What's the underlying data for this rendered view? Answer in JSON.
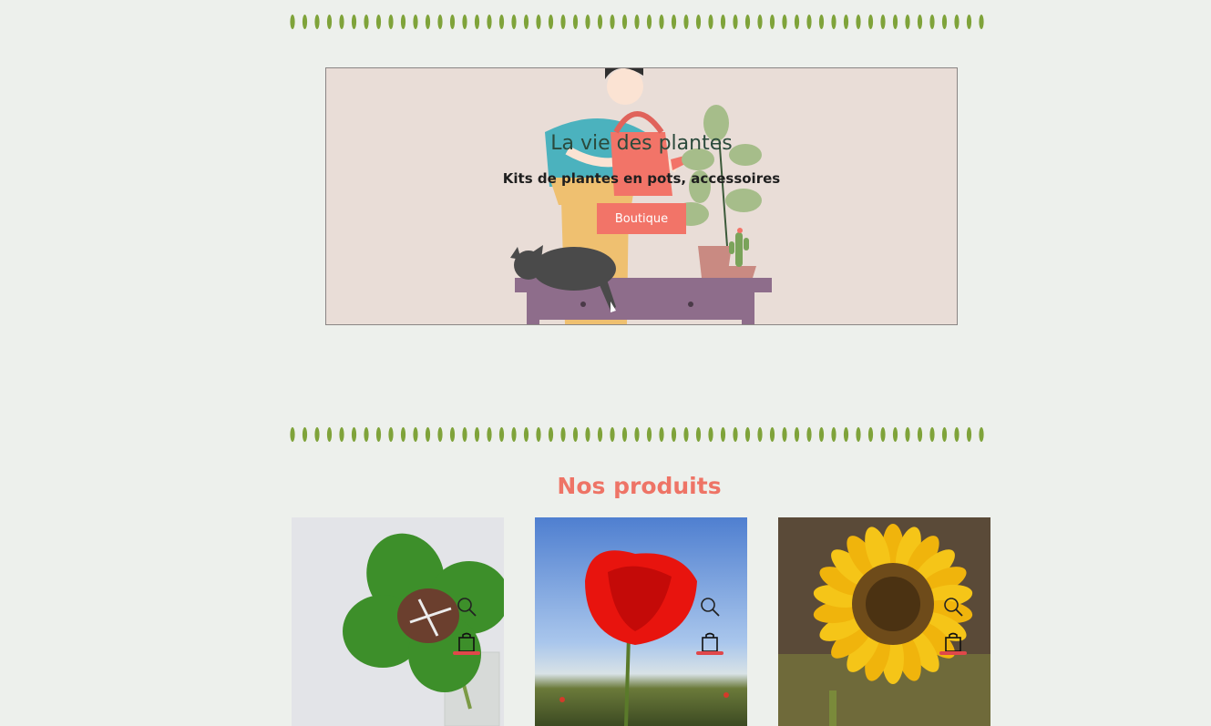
{
  "hero": {
    "title": "La vie des plantes",
    "subtitle": "Kits de plantes en pots, accessoires",
    "button_label": "Boutique"
  },
  "products_section": {
    "title": "Nos produits",
    "cards": [
      {
        "image": "four-leaf-clover-photo",
        "zoom_icon": "search-icon",
        "cart_icon": "shopping-bag-icon"
      },
      {
        "image": "red-poppy-photo",
        "zoom_icon": "search-icon",
        "cart_icon": "shopping-bag-icon"
      },
      {
        "image": "sunflower-photo",
        "zoom_icon": "search-icon",
        "cart_icon": "shopping-bag-icon"
      }
    ]
  },
  "colors": {
    "background": "#edf0ec",
    "accent": "#f27468",
    "section_title": "#ee7466",
    "leaf_divider": "#7fa33a",
    "cart_underline": "#e0474a"
  }
}
